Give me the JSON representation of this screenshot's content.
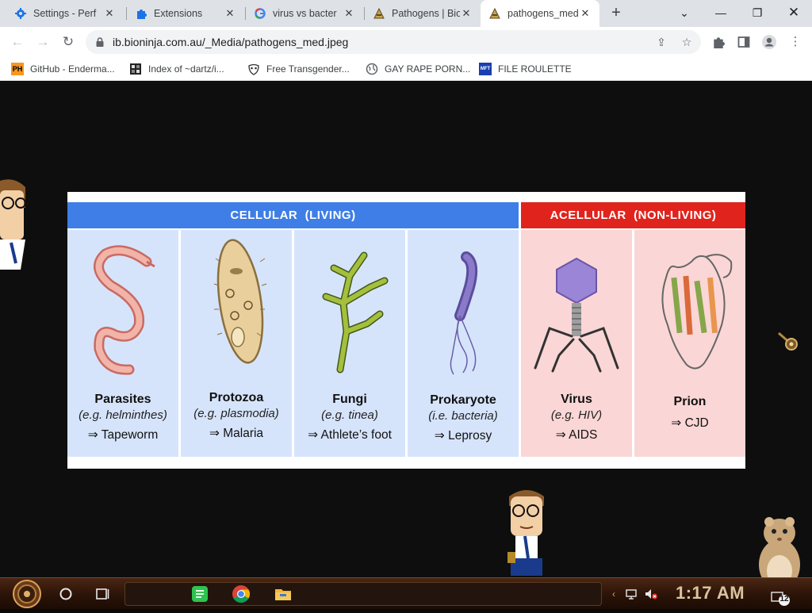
{
  "browser": {
    "tabs": [
      {
        "title": "Settings - Perf",
        "favicon": "gear-icon",
        "active": false
      },
      {
        "title": "Extensions",
        "favicon": "puzzle-icon",
        "active": false
      },
      {
        "title": "virus vs bacter",
        "favicon": "google-icon",
        "active": false
      },
      {
        "title": "Pathogens | Bio",
        "favicon": "bioninja-icon",
        "active": false
      },
      {
        "title": "pathogens_med",
        "favicon": "bioninja-icon",
        "active": true
      }
    ],
    "new_tab_label": "+",
    "address": "ib.bioninja.com.au/_Media/pathogens_med.jpeg",
    "bookmarks": [
      {
        "label": "GitHub - Enderma...",
        "icon": "ph-icon"
      },
      {
        "label": "Index of ~dartz/i...",
        "icon": "index-icon"
      },
      {
        "label": "Free Transgender...",
        "icon": "mask-icon"
      },
      {
        "label": "GAY RAPE PORN...",
        "icon": "globe-icon"
      },
      {
        "label": "FILE ROULETTE",
        "icon": "mft-icon"
      }
    ],
    "bookmark_badges": {
      "ph": "PH",
      "mft": "MFT"
    }
  },
  "figure": {
    "header_cellular": "CELLULAR  (LIVING)",
    "header_acellular": "ACELLULAR  (NON-LIVING)",
    "colors": {
      "cellular": "#3e7ee6",
      "acellular": "#e0241d",
      "cellular_bg": "#d6e4fb",
      "acellular_bg": "#fbd6d6"
    },
    "cards": [
      {
        "name": "Parasites",
        "example": "(e.g. helminthes)",
        "disease": "⇒ Tapeworm"
      },
      {
        "name": "Protozoa",
        "example": "(e.g. plasmodia)",
        "disease": "⇒ Malaria"
      },
      {
        "name": "Fungi",
        "example": "(e.g. tinea)",
        "disease": "⇒ Athlete’s foot"
      },
      {
        "name": "Prokaryote",
        "example": "(i.e. bacteria)",
        "disease": "⇒ Leprosy"
      },
      {
        "name": "Virus",
        "example": "(e.g. HIV)",
        "disease": "⇒ AIDS"
      },
      {
        "name": "Prion",
        "example": "",
        "disease": "⇒ CJD"
      }
    ]
  },
  "taskbar": {
    "clock": "1:17 AM",
    "notification_count": "12"
  }
}
